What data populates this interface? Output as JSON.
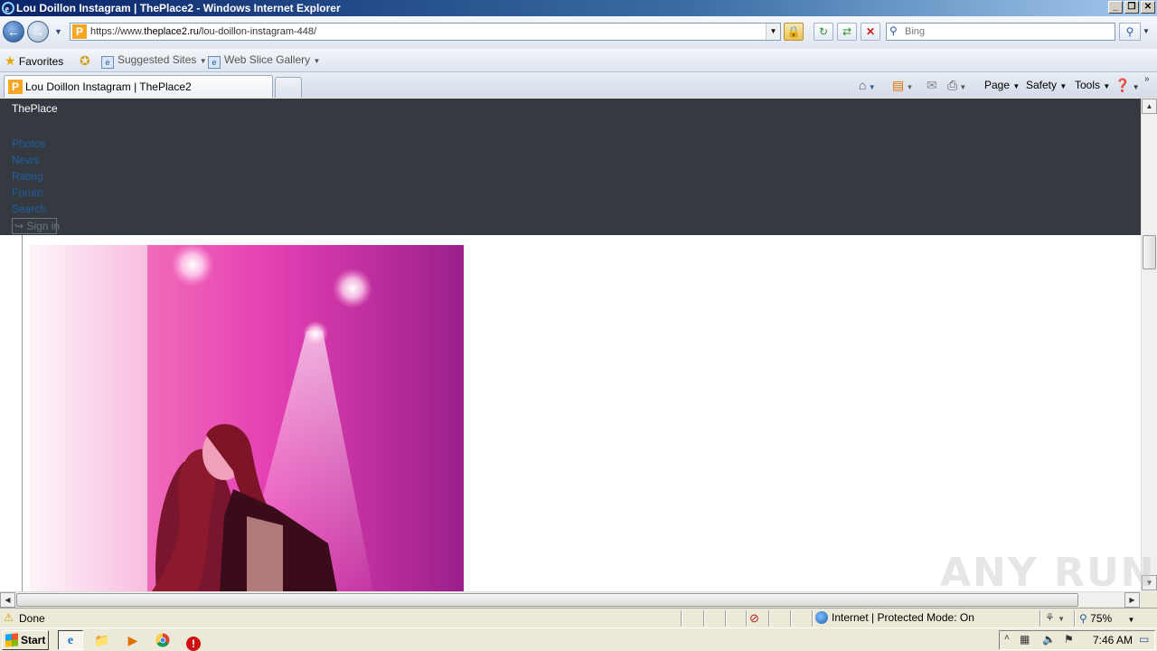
{
  "window": {
    "title": "Lou Doillon Instagram | ThePlace2 - Windows Internet Explorer",
    "controls": {
      "minimize": "_",
      "maximize": "❐",
      "close": "✕"
    }
  },
  "navbar": {
    "url_prefix": "https://www.",
    "url_domain": "theplace2.ru",
    "url_path": "/lou-doillon-instagram-448/",
    "search_placeholder": "Bing"
  },
  "favorites_bar": {
    "favorites_label": "Favorites",
    "suggested_sites_label": "Suggested Sites",
    "web_slice_label": "Web Slice Gallery"
  },
  "tabs": {
    "active_title": "Lou Doillon Instagram | ThePlace2",
    "favicon_letter": "P"
  },
  "command_bar": {
    "page_label": "Page",
    "safety_label": "Safety",
    "tools_label": "Tools"
  },
  "site": {
    "brand": "ThePlace",
    "nav_links": [
      "Photos",
      "News",
      "Rating",
      "Forum",
      "Search"
    ],
    "sign_in_label": "Sign in"
  },
  "status_bar": {
    "status_text": "Done",
    "zone_text": "Internet | Protected Mode: On",
    "zoom_text": "75%"
  },
  "taskbar": {
    "start_label": "Start",
    "clock": "7:46 AM"
  },
  "watermark": "ANY RUN",
  "colors": {
    "site_nav_bg": "#343a40",
    "site_link": "#1f5fa0",
    "photo_magenta": "#d61a8c"
  }
}
